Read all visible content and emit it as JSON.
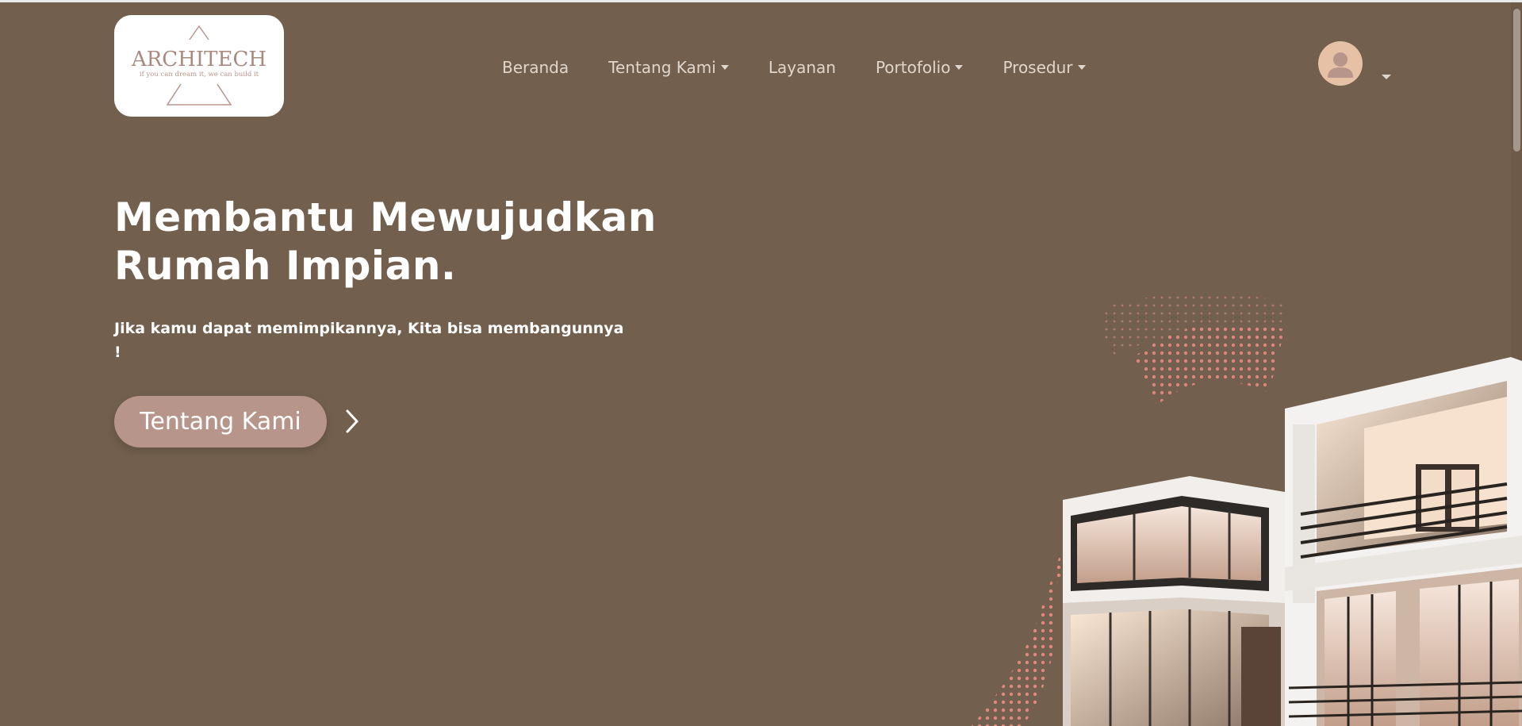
{
  "logo": {
    "wordmark": "ARCHITECH",
    "tagline": "if you can dream it, we can build it"
  },
  "nav": {
    "items": [
      {
        "label": "Beranda",
        "dropdown": false
      },
      {
        "label": "Tentang Kami",
        "dropdown": true
      },
      {
        "label": "Layanan",
        "dropdown": false
      },
      {
        "label": "Portofolio",
        "dropdown": true
      },
      {
        "label": "Prosedur",
        "dropdown": true
      }
    ]
  },
  "user": {
    "icon": "user-icon"
  },
  "hero": {
    "title_line1": "Membantu Mewujudkan",
    "title_line2": "Rumah Impian.",
    "subtitle": "Jika kamu dapat memimpikannya, Kita bisa membangunnya !",
    "cta_label": "Tentang Kami",
    "arrow_icon": "chevron-right-icon"
  },
  "colors": {
    "background": "#725f4d",
    "logo_accent": "#b8958a",
    "cta": "#b8958a",
    "avatar": "#e6c1a6",
    "dots": "#f08a82"
  }
}
